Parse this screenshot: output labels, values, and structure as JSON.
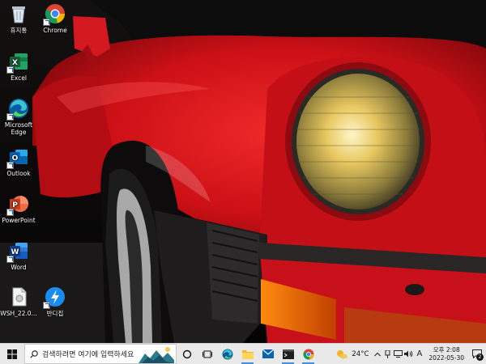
{
  "desktop": {
    "icons": [
      {
        "label": "휴지통",
        "icon": "recycle-bin-icon"
      },
      {
        "label": "Chrome",
        "icon": "chrome-icon"
      },
      {
        "label": "Excel",
        "icon": "excel-icon"
      },
      {
        "label": "Microsoft Edge",
        "icon": "edge-icon"
      },
      {
        "label": "Outlook",
        "icon": "outlook-icon"
      },
      {
        "label": "PowerPoint",
        "icon": "powerpoint-icon"
      },
      {
        "label": "Word",
        "icon": "word-icon"
      },
      {
        "label": "WSH_22.0...",
        "icon": "setup-file-icon"
      },
      {
        "label": "반디집",
        "icon": "bandizip-icon"
      }
    ],
    "wallpaper": "red-porsche-911-headlight"
  },
  "taskbar": {
    "search": {
      "placeholder": "검색하려면 여기에 입력하세요"
    },
    "pinned": [
      {
        "name": "cortana",
        "icon": "cortana-circle-icon"
      },
      {
        "name": "task-view",
        "icon": "task-view-icon"
      },
      {
        "name": "edge",
        "icon": "edge-icon"
      },
      {
        "name": "file-explorer",
        "icon": "folder-icon"
      },
      {
        "name": "mail",
        "icon": "mail-icon"
      },
      {
        "name": "terminal",
        "icon": "terminal-icon"
      },
      {
        "name": "chrome",
        "icon": "chrome-icon"
      }
    ],
    "weather": {
      "temp": "24°C",
      "icon": "sun-cloud-icon"
    },
    "tray": {
      "ime": "A"
    },
    "clock": {
      "time": "오후 2:08",
      "date": "2022-05-30"
    },
    "notifications": {
      "count": "2"
    }
  },
  "colors": {
    "car_red": "#d3141c",
    "taskbar_bg": "#e9e9ea",
    "accent_blue": "#0078d4"
  }
}
